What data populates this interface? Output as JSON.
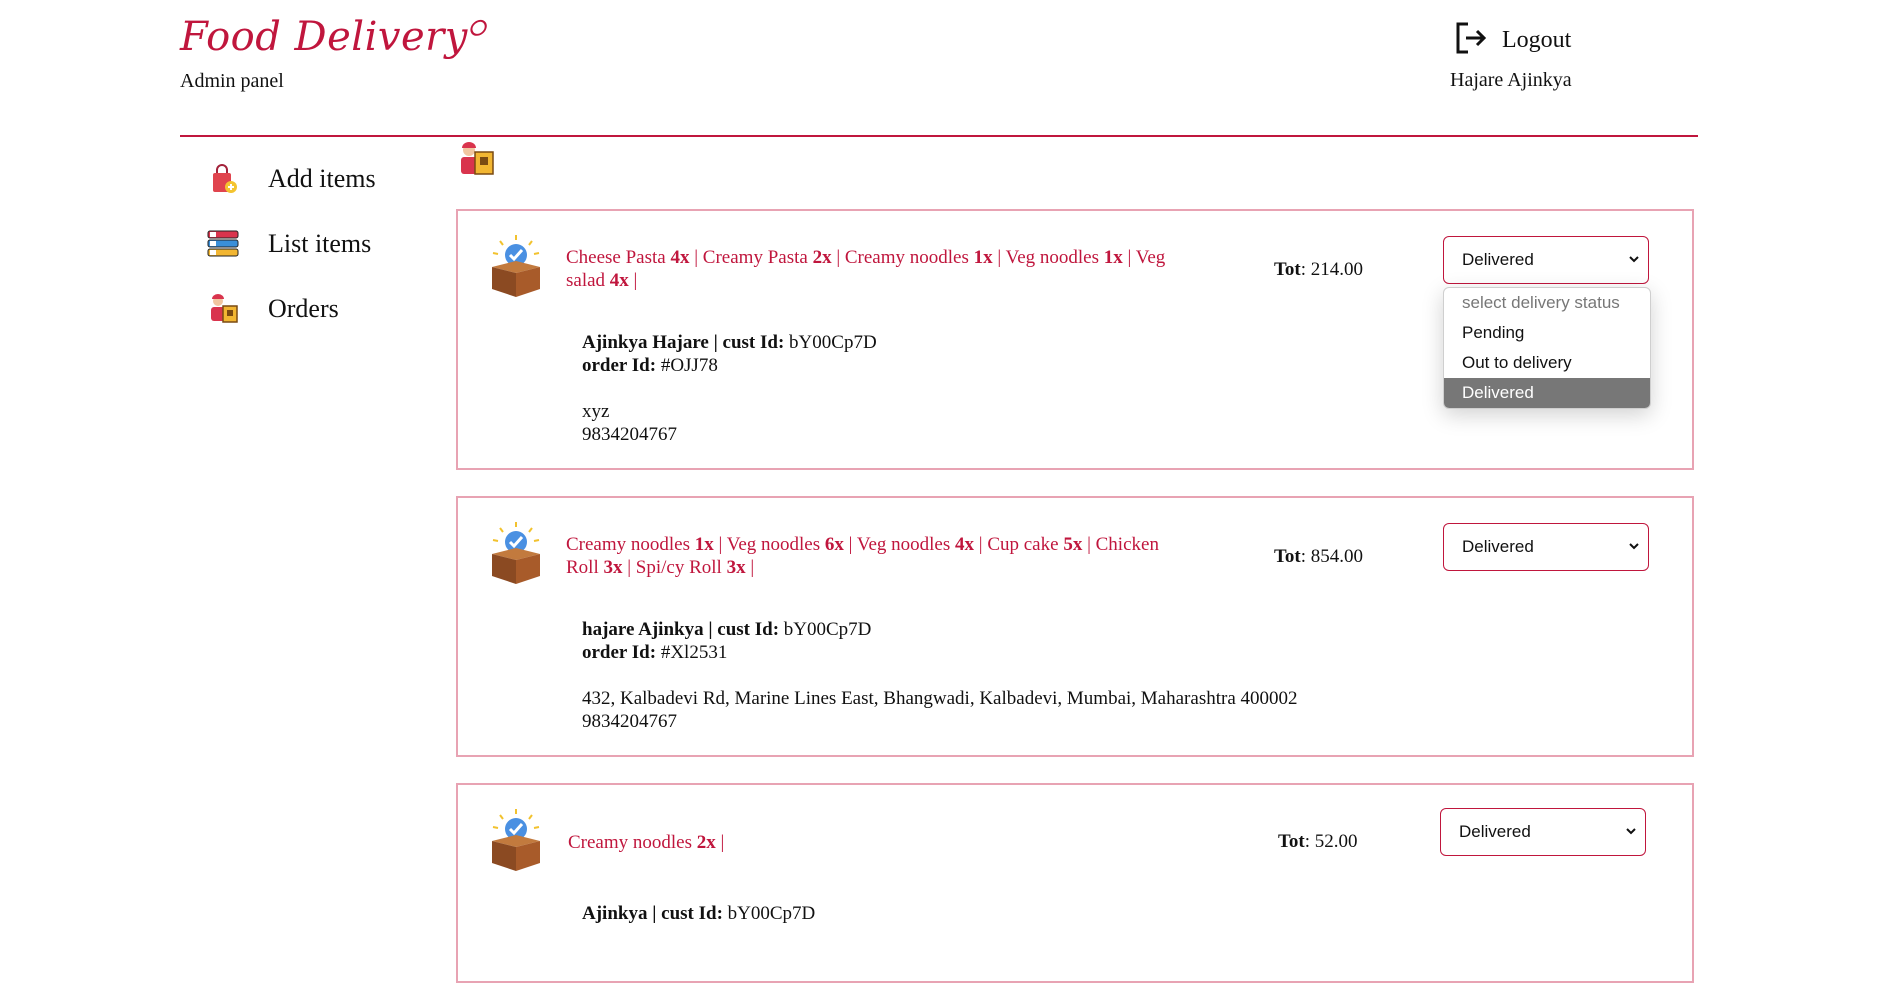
{
  "header": {
    "brand": "Food Delivery",
    "subtitle": "Admin panel",
    "logout_label": "Logout",
    "username": "Hajare Ajinkya"
  },
  "sidebar": {
    "items": [
      {
        "label": "Add items",
        "icon": "shopping-bag-add-icon"
      },
      {
        "label": "List items",
        "icon": "list-icon"
      },
      {
        "label": "Orders",
        "icon": "delivery-person-icon"
      }
    ]
  },
  "orders": [
    {
      "items_prefix": "",
      "items": [
        {
          "name": "Cheese Pasta",
          "qty": "4x"
        },
        {
          "name": "Creamy Pasta",
          "qty": "2x"
        },
        {
          "name": "Creamy noodles",
          "qty": "1x"
        },
        {
          "name": "Veg noodles",
          "qty": "1x"
        },
        {
          "name": "Veg salad",
          "qty": "4x"
        }
      ],
      "tot_label": "Tot",
      "total": "214.00",
      "customer": "Ajinkya Hajare | cust Id:",
      "cust_id": "bY00Cp7D",
      "order_label": "order Id:",
      "order_id": "#OJJ78",
      "address": "xyz",
      "phone": "9834204767",
      "status": "Delivered"
    },
    {
      "items": [
        {
          "name": "Creamy noodles",
          "qty": "1x"
        },
        {
          "name": "Veg noodles",
          "qty": "6x"
        },
        {
          "name": "Veg noodles",
          "qty": "4x"
        },
        {
          "name": "Cup cake",
          "qty": "5x"
        },
        {
          "name": "Chicken Roll",
          "qty": "3x"
        },
        {
          "name": "Spi/cy Roll",
          "qty": "3x"
        }
      ],
      "tot_label": "Tot",
      "total": "854.00",
      "customer": "hajare Ajinkya | cust Id:",
      "cust_id": "bY00Cp7D",
      "order_label": "order Id:",
      "order_id": "#Xl2531",
      "address": "432, Kalbadevi Rd, Marine Lines East, Bhangwadi, Kalbadevi, Mumbai, Maharashtra 400002",
      "phone": "9834204767",
      "status": "Delivered"
    },
    {
      "items": [
        {
          "name": "Creamy noodles",
          "qty": "2x"
        }
      ],
      "tot_label": "Tot",
      "total": "52.00",
      "customer": "Ajinkya | cust Id:",
      "cust_id": "bY00Cp7D",
      "status": "Delivered"
    }
  ],
  "status_dropdown": {
    "options": [
      "select delivery status",
      "Pending",
      "Out to delivery",
      "Delivered"
    ],
    "selected": "Delivered"
  },
  "colors": {
    "accent": "#c0163d",
    "card_border": "#e8a3b3",
    "selected_option_bg": "#777777"
  }
}
